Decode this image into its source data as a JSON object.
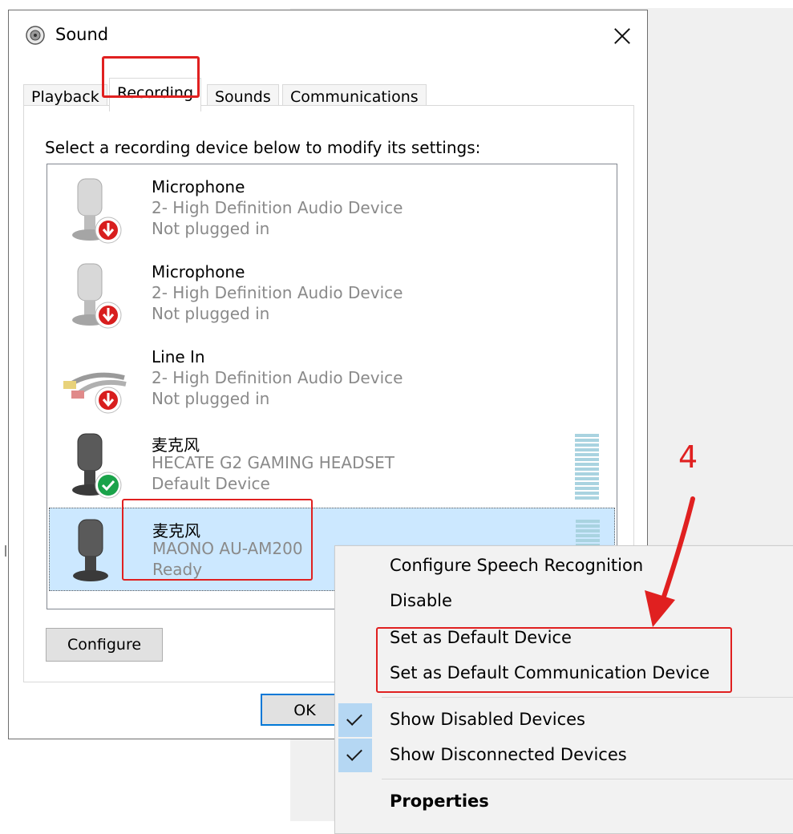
{
  "window": {
    "title": "Sound",
    "close_label": "Close"
  },
  "tabs": [
    {
      "label": "Playback",
      "active": false
    },
    {
      "label": "Recording",
      "active": true
    },
    {
      "label": "Sounds",
      "active": false
    },
    {
      "label": "Communications",
      "active": false
    }
  ],
  "panel": {
    "instruction": "Select a recording device below to modify its settings:"
  },
  "devices": [
    {
      "name": "Microphone",
      "line2": "2- High Definition Audio Device",
      "line3": "Not plugged in",
      "icon": "microphone-icon",
      "status_icon": "unplugged-arrow-icon"
    },
    {
      "name": "Microphone",
      "line2": "2- High Definition Audio Device",
      "line3": "Not plugged in",
      "icon": "microphone-icon",
      "status_icon": "unplugged-arrow-icon"
    },
    {
      "name": "Line In",
      "line2": "2- High Definition Audio Device",
      "line3": "Not plugged in",
      "icon": "rca-cable-icon",
      "status_icon": "unplugged-arrow-icon"
    },
    {
      "name": "麦克风",
      "line2": "HECATE G2 GAMING HEADSET",
      "line3": "Default Device",
      "icon": "microphone-icon",
      "status_icon": "default-check-icon"
    },
    {
      "name": "麦克风",
      "line2": "MAONO AU-AM200",
      "line3": "Ready",
      "icon": "microphone-icon",
      "status_icon": "",
      "selected": true
    }
  ],
  "buttons": {
    "configure": "Configure",
    "ok": "OK"
  },
  "context_menu": {
    "items": [
      "Configure Speech Recognition",
      "Disable",
      "Set as Default Device",
      "Set as Default Communication Device",
      "Show Disabled Devices",
      "Show Disconnected Devices",
      "Properties"
    ],
    "checked": [
      false,
      false,
      false,
      false,
      true,
      true,
      false
    ]
  },
  "annotation": {
    "step_number": "4"
  },
  "colors": {
    "annotation_red": "#e02020",
    "selection_blue": "#cce8ff",
    "check_blue": "#b5d7f3",
    "green_check": "#1aa34a",
    "red_arrow_badge": "#d81e1e"
  }
}
